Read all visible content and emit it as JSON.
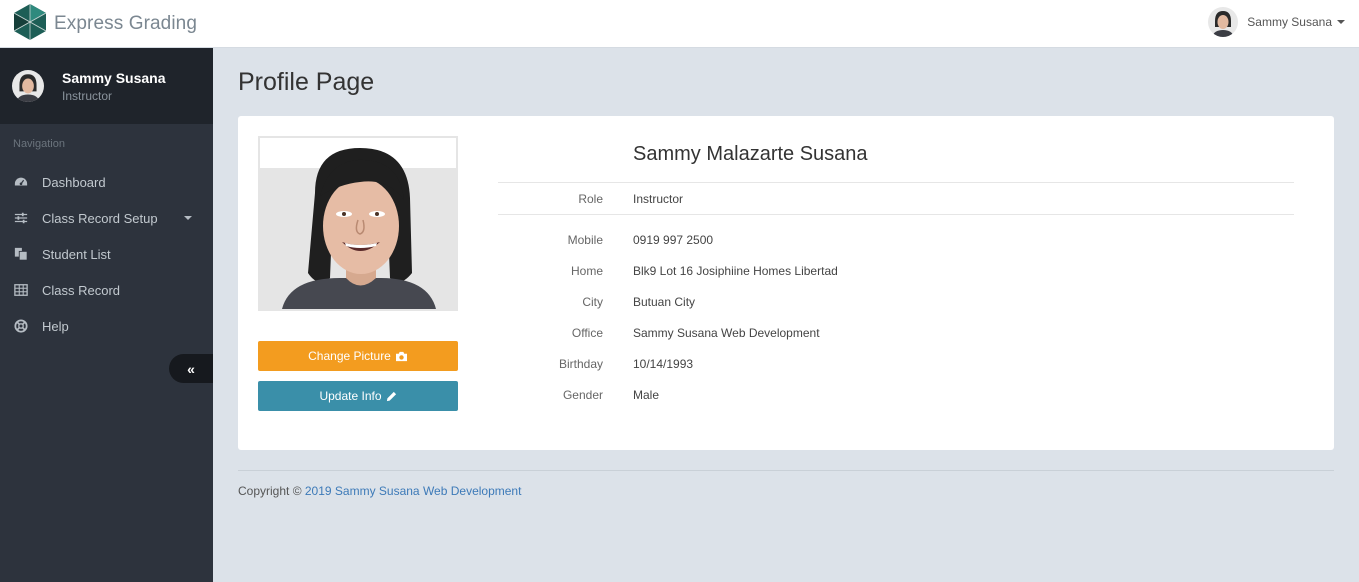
{
  "app": {
    "brand": "Express Grading"
  },
  "topbar": {
    "user_name": "Sammy Susana"
  },
  "sidebar": {
    "user_name": "Sammy Susana",
    "user_role": "Instructor",
    "nav_heading": "Navigation",
    "items": [
      {
        "label": "Dashboard",
        "icon": "dashboard-icon"
      },
      {
        "label": "Class Record Setup",
        "icon": "sliders-icon",
        "has_dropdown": true
      },
      {
        "label": "Student List",
        "icon": "copy-icon"
      },
      {
        "label": "Class Record",
        "icon": "table-icon"
      },
      {
        "label": "Help",
        "icon": "life-ring-icon"
      }
    ]
  },
  "page": {
    "title": "Profile Page"
  },
  "profile": {
    "full_name": "Sammy Malazarte Susana",
    "change_picture_label": "Change Picture",
    "update_info_label": "Update Info",
    "fields": {
      "role": {
        "label": "Role",
        "value": "Instructor"
      },
      "mobile": {
        "label": "Mobile",
        "value": "0919 997 2500"
      },
      "home": {
        "label": "Home",
        "value": "Blk9 Lot 16 Josiphiine Homes Libertad"
      },
      "city": {
        "label": "City",
        "value": "Butuan City"
      },
      "office": {
        "label": "Office",
        "value": "Sammy Susana Web Development"
      },
      "birthday": {
        "label": "Birthday",
        "value": "10/14/1993"
      },
      "gender": {
        "label": "Gender",
        "value": "Male"
      }
    }
  },
  "footer": {
    "prefix": "Copyright © ",
    "link_text": "2019 Sammy Susana Web Development"
  },
  "colors": {
    "sidebar_bg": "#2d333d",
    "sidebar_profile_bg": "#1f242b",
    "content_bg": "#dce2e9",
    "change_picture_btn": "#f39c1f",
    "update_info_btn": "#3a8fa9",
    "link": "#3d7ab8"
  }
}
